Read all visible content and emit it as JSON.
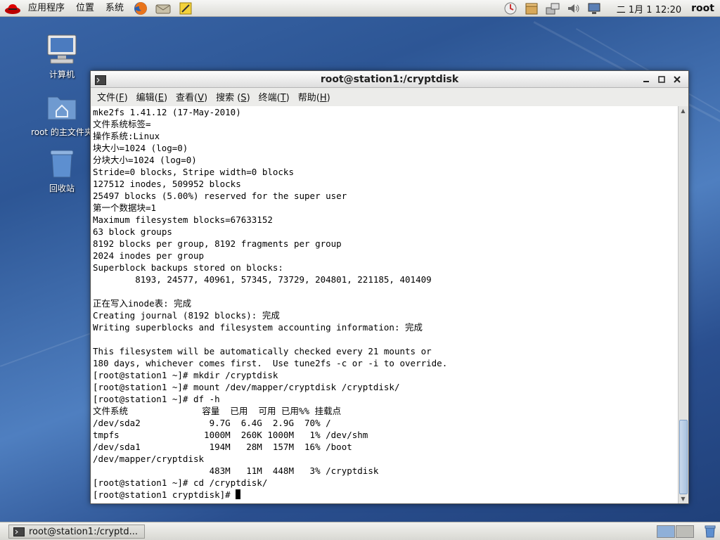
{
  "top_panel": {
    "menus": [
      "应用程序",
      "位置",
      "系统"
    ],
    "clock": "二 1月 1 12:20",
    "user": "root",
    "launchers": [
      "firefox-icon",
      "mail-icon",
      "notes-icon"
    ],
    "tray_icons": [
      "update-icon",
      "package-icon",
      "network-icon",
      "volume-icon",
      "display-icon"
    ]
  },
  "desktop": {
    "icons": [
      {
        "label": "计算机",
        "icon": "computer-icon"
      },
      {
        "label": "root 的主文件夹",
        "icon": "home-folder-icon"
      },
      {
        "label": "回收站",
        "icon": "trash-icon"
      }
    ]
  },
  "window": {
    "title": "root@station1:/cryptdisk",
    "menu": [
      {
        "pre": "文件(",
        "key": "F",
        "post": ")"
      },
      {
        "pre": "编辑(",
        "key": "E",
        "post": ")"
      },
      {
        "pre": "查看(",
        "key": "V",
        "post": ")"
      },
      {
        "pre": "搜索 (",
        "key": "S",
        "post": ")"
      },
      {
        "pre": "终端(",
        "key": "T",
        "post": ")"
      },
      {
        "pre": "帮助(",
        "key": "H",
        "post": ")"
      }
    ],
    "terminal_lines": [
      "mke2fs 1.41.12 (17-May-2010)",
      "文件系统标签=",
      "操作系统:Linux",
      "块大小=1024 (log=0)",
      "分块大小=1024 (log=0)",
      "Stride=0 blocks, Stripe width=0 blocks",
      "127512 inodes, 509952 blocks",
      "25497 blocks (5.00%) reserved for the super user",
      "第一个数据块=1",
      "Maximum filesystem blocks=67633152",
      "63 block groups",
      "8192 blocks per group, 8192 fragments per group",
      "2024 inodes per group",
      "Superblock backups stored on blocks:",
      "        8193, 24577, 40961, 57345, 73729, 204801, 221185, 401409",
      "",
      "正在写入inode表: 完成",
      "Creating journal (8192 blocks): 完成",
      "Writing superblocks and filesystem accounting information: 完成",
      "",
      "This filesystem will be automatically checked every 21 mounts or",
      "180 days, whichever comes first.  Use tune2fs -c or -i to override.",
      "[root@station1 ~]# mkdir /cryptdisk",
      "[root@station1 ~]# mount /dev/mapper/cryptdisk /cryptdisk/",
      "[root@station1 ~]# df -h",
      "文件系统              容量  已用  可用 已用%% 挂载点",
      "/dev/sda2             9.7G  6.4G  2.9G  70% /",
      "tmpfs                1000M  260K 1000M   1% /dev/shm",
      "/dev/sda1             194M   28M  157M  16% /boot",
      "/dev/mapper/cryptdisk",
      "                      483M   11M  448M   3% /cryptdisk",
      "[root@station1 ~]# cd /cryptdisk/"
    ],
    "prompt": "[root@station1 cryptdisk]# ",
    "scroll_position": 0.95
  },
  "taskbar": {
    "task_label": "root@station1:/cryptd..."
  },
  "colors": {
    "desktop": "#2d5695",
    "panel": "#e6e6e2",
    "terminal_bg": "#ffffff",
    "terminal_fg": "#000000",
    "scroll_thumb": "#a9c2df"
  }
}
